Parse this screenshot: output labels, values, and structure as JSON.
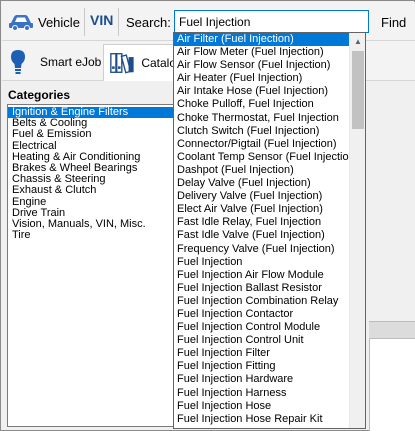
{
  "toolbar": {
    "vehicle_label": "Vehicle",
    "vin_label": "VIN",
    "search_label": "Search:",
    "search_value": "Fuel Injection",
    "find_label": "Find"
  },
  "toolbar2": {
    "smart_ejob_label": "Smart eJob",
    "catalog_label": "Catalo"
  },
  "categories": {
    "header": "Categories",
    "items": [
      "Ignition & Engine Filters",
      "Belts & Cooling",
      "Fuel & Emission",
      "Electrical",
      "Heating & Air Conditioning",
      "Brakes & Wheel Bearings",
      "Chassis & Steering",
      "Exhaust & Clutch",
      "Engine",
      "Drive Train",
      "Vision, Manuals, VIN, Misc.",
      "Tire"
    ],
    "selected_index": 0
  },
  "dropdown": {
    "items": [
      "Air Filter (Fuel Injection)",
      "Air Flow Meter (Fuel Injection)",
      "Air Flow Sensor (Fuel Injection)",
      "Air Heater (Fuel Injection)",
      "Air Intake Hose (Fuel Injection)",
      "Choke Pulloff, Fuel Injection",
      "Choke Thermostat, Fuel Injection",
      "Clutch Switch (Fuel Injection)",
      "Connector/Pigtail (Fuel Injection)",
      "Coolant Temp Sensor (Fuel Injection)",
      "Dashpot (Fuel Injection)",
      "Delay Valve (Fuel Injection)",
      "Delivery Valve (Fuel Injection)",
      "Elect Air Valve (Fuel Injection)",
      "Fast Idle Relay, Fuel Injection",
      "Fast Idle Valve (Fuel Injection)",
      "Frequency Valve (Fuel Injection)",
      "Fuel Injection",
      "Fuel Injection Air Flow Module",
      "Fuel Injection Ballast Resistor",
      "Fuel Injection Combination Relay",
      "Fuel Injection Contactor",
      "Fuel Injection Control Module",
      "Fuel Injection Control Unit",
      "Fuel Injection Filter",
      "Fuel Injection Fitting",
      "Fuel Injection Hardware",
      "Fuel Injection Harness",
      "Fuel Injection Hose",
      "Fuel Injection Hose Repair Kit"
    ],
    "selected_index": 0
  },
  "colors": {
    "accent": "#0078d7",
    "vin": "#1e4d8c",
    "vehicle_icon": "#3a72c4"
  },
  "icons": {
    "vehicle": "car-icon",
    "smart_ejob": "lightbulb-icon",
    "catalog": "books-icon"
  }
}
